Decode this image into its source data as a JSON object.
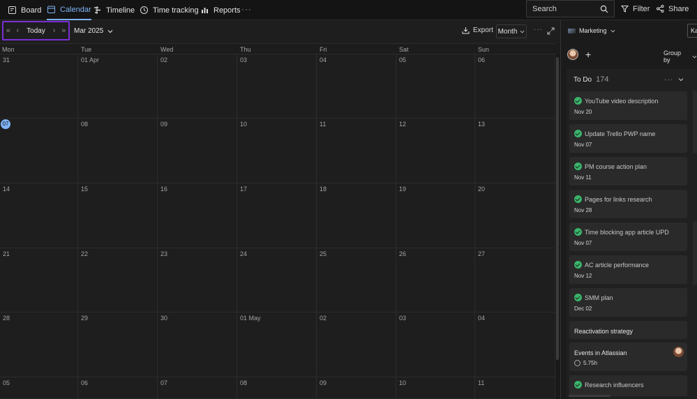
{
  "nav": {
    "tabs": [
      {
        "label": "Board",
        "icon": "board-icon"
      },
      {
        "label": "Calendar",
        "icon": "calendar-icon",
        "active": true
      },
      {
        "label": "Timeline",
        "icon": "timeline-icon"
      },
      {
        "label": "Time tracking",
        "icon": "clock-icon"
      },
      {
        "label": "Reports",
        "icon": "reports-icon"
      }
    ],
    "more": "···",
    "search_placeholder": "Search",
    "filter_label": "Filter",
    "share_label": "Share"
  },
  "toolbar": {
    "first": "«",
    "prev": "‹",
    "today": "Today",
    "next": "›",
    "last": "»",
    "date": "Mar 2025",
    "export": "Export",
    "view": "Month",
    "more": "···"
  },
  "calendar": {
    "weekdays": [
      "Mon",
      "Tue",
      "Wed",
      "Thu",
      "Fri",
      "Sat",
      "Sun"
    ],
    "weeks": [
      [
        "31",
        "01 Apr",
        "02",
        "03",
        "04",
        "05",
        "06"
      ],
      [
        "07",
        "08",
        "09",
        "10",
        "11",
        "12",
        "13"
      ],
      [
        "14",
        "15",
        "16",
        "17",
        "18",
        "19",
        "20"
      ],
      [
        "21",
        "22",
        "23",
        "24",
        "25",
        "26",
        "27"
      ],
      [
        "28",
        "29",
        "30",
        "01 May",
        "02",
        "03",
        "04"
      ],
      [
        "05",
        "06",
        "07",
        "08",
        "09",
        "10",
        "11"
      ]
    ],
    "today": "07",
    "accent": "#7fb3f5"
  },
  "panel": {
    "project": "Marketing",
    "view_button": "Ka",
    "group_by": "Group by",
    "column": {
      "title": "To Do",
      "count": "174",
      "more": "···"
    },
    "cards": [
      {
        "title": "YouTube video description",
        "due": "Nov 20",
        "done": true
      },
      {
        "title": "Update Trello PWP name",
        "due": "Nov 07",
        "done": true
      },
      {
        "title": "PM course action plan",
        "due": "Nov 11",
        "done": true
      },
      {
        "title": "Pages for links research",
        "due": "Nov 28",
        "done": true
      },
      {
        "title": "Time blocking app article UPD",
        "due": "Nov 07",
        "done": true
      },
      {
        "title": "AC article performance",
        "due": "Nov 12",
        "done": true
      },
      {
        "title": "SMM plan",
        "due": "Dec 02",
        "done": true
      },
      {
        "title": "Reactivation strategy"
      },
      {
        "title": "Events in Atlassian",
        "time": "5.75h",
        "avatar": true
      },
      {
        "title": "Research influencers",
        "done": true
      }
    ],
    "done_color": "#3ab56b"
  }
}
